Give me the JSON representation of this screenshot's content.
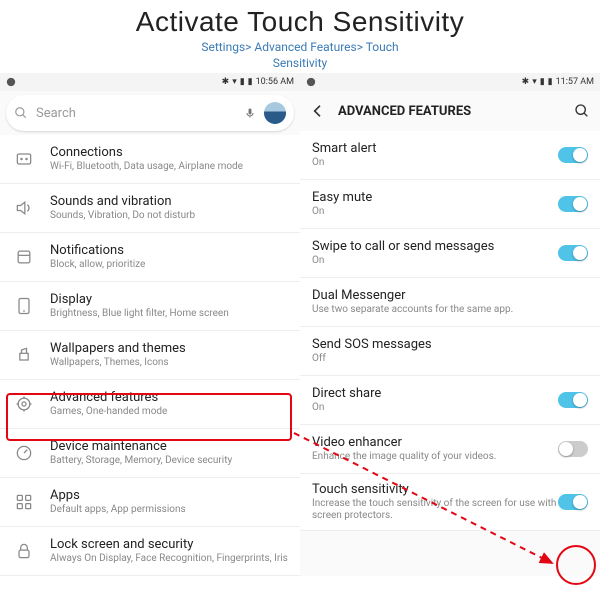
{
  "header": {
    "title": "Activate Touch Sensitivity",
    "breadcrumb_line1": "Settings> Advanced Features> Touch",
    "breadcrumb_line2": "Sensitivity"
  },
  "left": {
    "status": {
      "time": "10:56 AM"
    },
    "search": {
      "placeholder": "Search"
    },
    "rows": [
      {
        "icon": "connections",
        "title": "Connections",
        "sub": "Wi-Fi, Bluetooth, Data usage, Airplane mode"
      },
      {
        "icon": "sound",
        "title": "Sounds and vibration",
        "sub": "Sounds, Vibration, Do not disturb"
      },
      {
        "icon": "notif",
        "title": "Notifications",
        "sub": "Block, allow, prioritize"
      },
      {
        "icon": "display",
        "title": "Display",
        "sub": "Brightness, Blue light filter, Home screen"
      },
      {
        "icon": "wallpaper",
        "title": "Wallpapers and themes",
        "sub": "Wallpapers, Themes, Icons"
      },
      {
        "icon": "advanced",
        "title": "Advanced features",
        "sub": "Games, One-handed mode"
      },
      {
        "icon": "maintenance",
        "title": "Device maintenance",
        "sub": "Battery, Storage, Memory, Device security"
      },
      {
        "icon": "apps",
        "title": "Apps",
        "sub": "Default apps, App permissions"
      },
      {
        "icon": "lock",
        "title": "Lock screen and security",
        "sub": "Always On Display, Face Recognition, Fingerprints, Iris"
      }
    ]
  },
  "right": {
    "status": {
      "time": "11:57 AM"
    },
    "header": {
      "title": "ADVANCED FEATURES"
    },
    "rows": [
      {
        "title": "Smart alert",
        "sub": "On",
        "toggle": "on"
      },
      {
        "title": "Easy mute",
        "sub": "On",
        "toggle": "on"
      },
      {
        "title": "Swipe to call or send messages",
        "sub": "On",
        "toggle": "on"
      },
      {
        "title": "Dual Messenger",
        "sub": "Use two separate accounts for the same app.",
        "toggle": null
      },
      {
        "title": "Send SOS messages",
        "sub": "Off",
        "toggle": null
      },
      {
        "title": "Direct share",
        "sub": "On",
        "toggle": "on"
      },
      {
        "title": "Video enhancer",
        "sub": "Enhance the image quality of your videos.",
        "toggle": "off"
      },
      {
        "title": "Touch sensitivity",
        "sub": "Increase the touch sensitivity of the screen for use with screen protectors.",
        "toggle": "on"
      }
    ]
  }
}
